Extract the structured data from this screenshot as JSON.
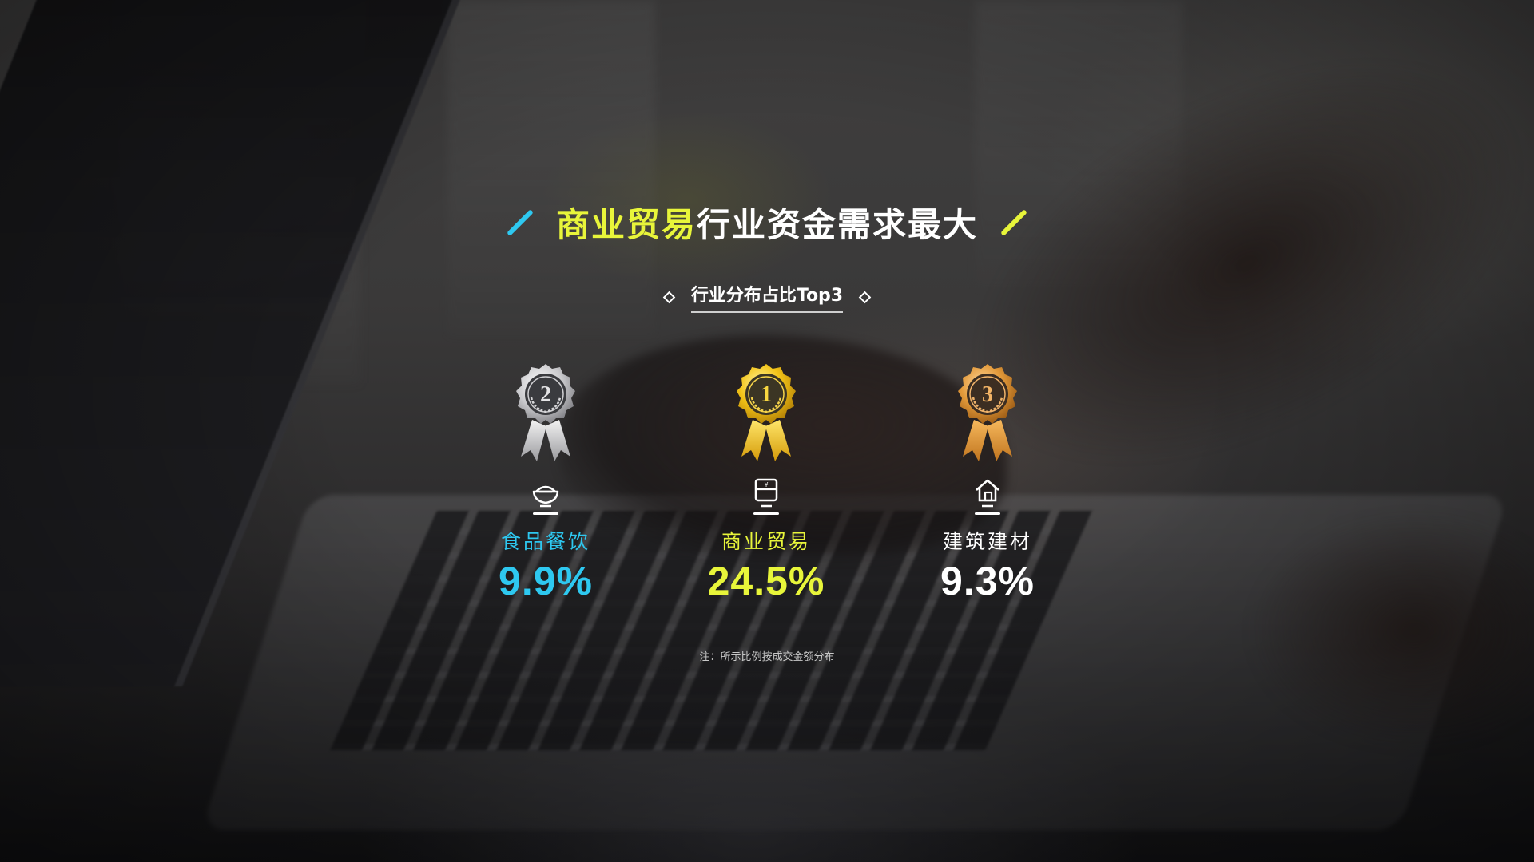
{
  "title": {
    "highlight": "商业贸易",
    "rest": "行业资金需求最大"
  },
  "subtitle": "行业分布占比Top3",
  "rankings": [
    {
      "rank": "2",
      "category": "食品餐饮",
      "value": "9.9%",
      "medal": "silver",
      "icon": "rice-bowl-icon",
      "color": "#2ec8f0"
    },
    {
      "rank": "1",
      "category": "商业贸易",
      "value": "24.5%",
      "medal": "gold",
      "icon": "yuan-calendar-icon",
      "color": "#e8f53a"
    },
    {
      "rank": "3",
      "category": "建筑建材",
      "value": "9.3%",
      "medal": "bronze",
      "icon": "house-icon",
      "color": "#ffffff"
    }
  ],
  "note": "注：所示比例按成交金额分布",
  "colors": {
    "accent_blue": "#2ec8f0",
    "accent_yellow": "#e8f53a",
    "text": "#ffffff"
  }
}
